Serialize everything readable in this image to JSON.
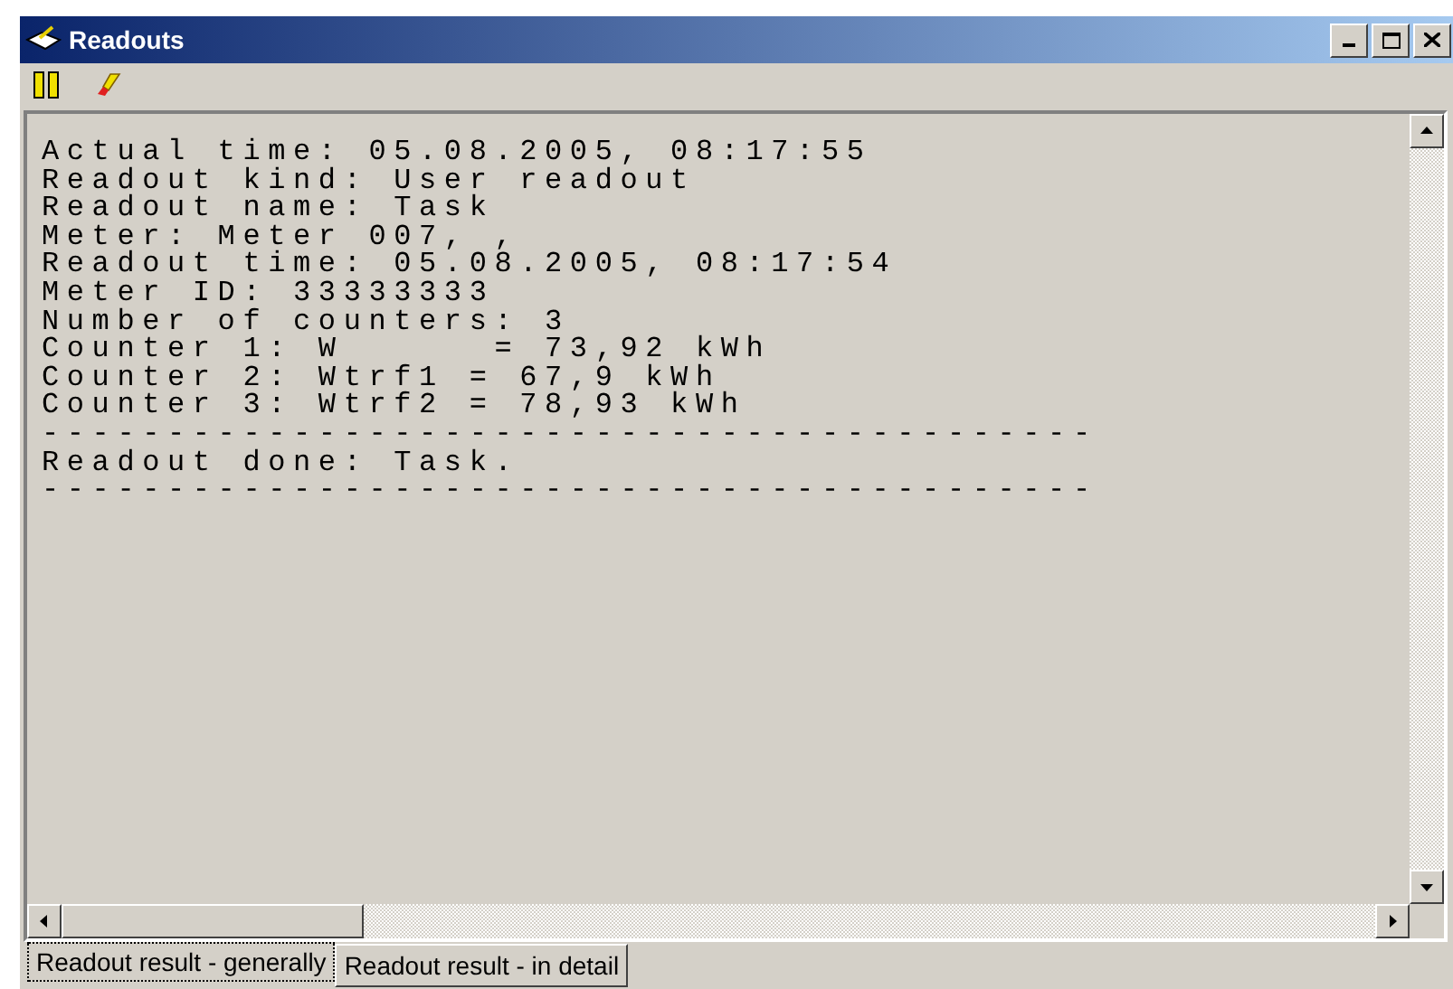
{
  "window": {
    "title": "Readouts"
  },
  "lines": [
    "Actual time: 05.08.2005, 08:17:55",
    "Readout kind: User readout",
    "Readout name: Task",
    "Meter: Meter 007, ,",
    "Readout time: 05.08.2005, 08:17:54",
    "Meter ID: 33333333",
    "Number of counters: 3",
    "Counter 1: W      = 73,92 kWh",
    "Counter 2: Wtrf1 = 67,9 kWh",
    "Counter 3: Wtrf2 = 78,93 kWh",
    "------------------------------------------",
    "Readout done: Task.",
    "------------------------------------------"
  ],
  "tabs": [
    {
      "label": "Readout result - generally",
      "selected": true
    },
    {
      "label": "Readout result - in detail",
      "selected": false
    }
  ]
}
